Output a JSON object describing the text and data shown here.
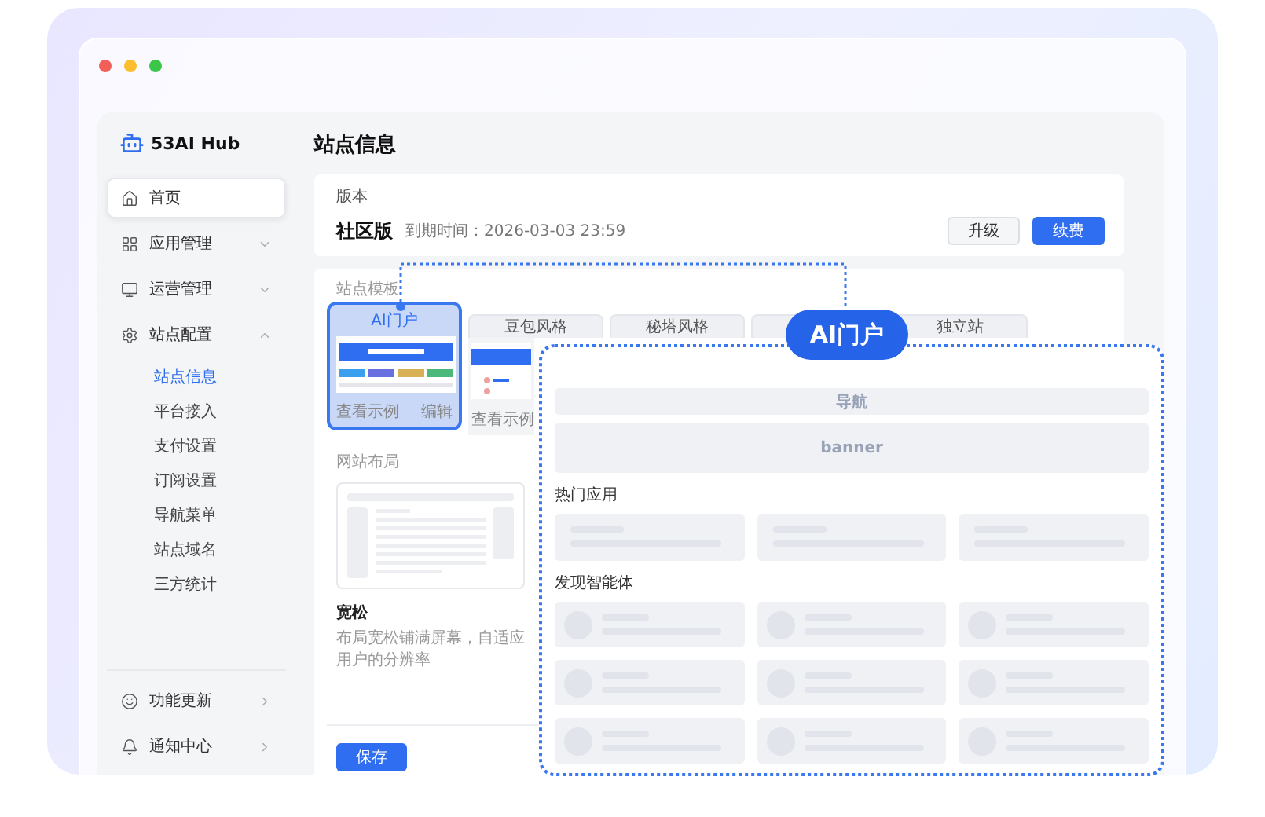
{
  "app": {
    "logo": "53AI Hub"
  },
  "sidebar": {
    "items": [
      {
        "label": "首页",
        "hovered": true
      },
      {
        "label": "应用管理",
        "expanded": false
      },
      {
        "label": "运营管理",
        "expanded": false
      },
      {
        "label": "站点配置",
        "expanded": true,
        "children": [
          {
            "label": "站点信息",
            "selected": true
          },
          {
            "label": "平台接入",
            "selected": false
          },
          {
            "label": "支付设置",
            "selected": false
          },
          {
            "label": "订阅设置",
            "selected": false
          },
          {
            "label": "导航菜单",
            "selected": false
          },
          {
            "label": "站点域名",
            "selected": false
          },
          {
            "label": "三方统计",
            "selected": false
          }
        ]
      }
    ],
    "bottom_items": [
      {
        "label": "功能更新"
      },
      {
        "label": "通知中心"
      }
    ]
  },
  "page_title": "站点信息",
  "version": {
    "label": "版本",
    "name": "社区版",
    "expiry": "到期时间：2026-03-03 23:59",
    "buttons": [
      {
        "label": "升级",
        "primary": false
      },
      {
        "label": "续费",
        "primary": true
      }
    ]
  },
  "templates": {
    "label": "站点模板",
    "cards": [
      {
        "title": "AI门户",
        "selected": true,
        "footer": [
          "查看示例",
          "编辑"
        ]
      },
      {
        "title": "豆包风格",
        "selected": false,
        "footer": [
          "查看示例"
        ]
      },
      {
        "title": "秘塔风格",
        "selected": false
      },
      {
        "selected": false
      },
      {
        "title": "独立站",
        "selected": false
      }
    ]
  },
  "layout": {
    "label": "网站布局",
    "name": "宽松",
    "description": "布局宽松铺满屏幕，自适应用户的分辨率"
  },
  "save_button": "保存",
  "preview": {
    "badge": "AI门户",
    "nav": "导航",
    "banner": "banner",
    "sections": [
      {
        "title": "热门应用",
        "kind": "app"
      },
      {
        "title": "发现智能体",
        "kind": "agent"
      }
    ]
  }
}
